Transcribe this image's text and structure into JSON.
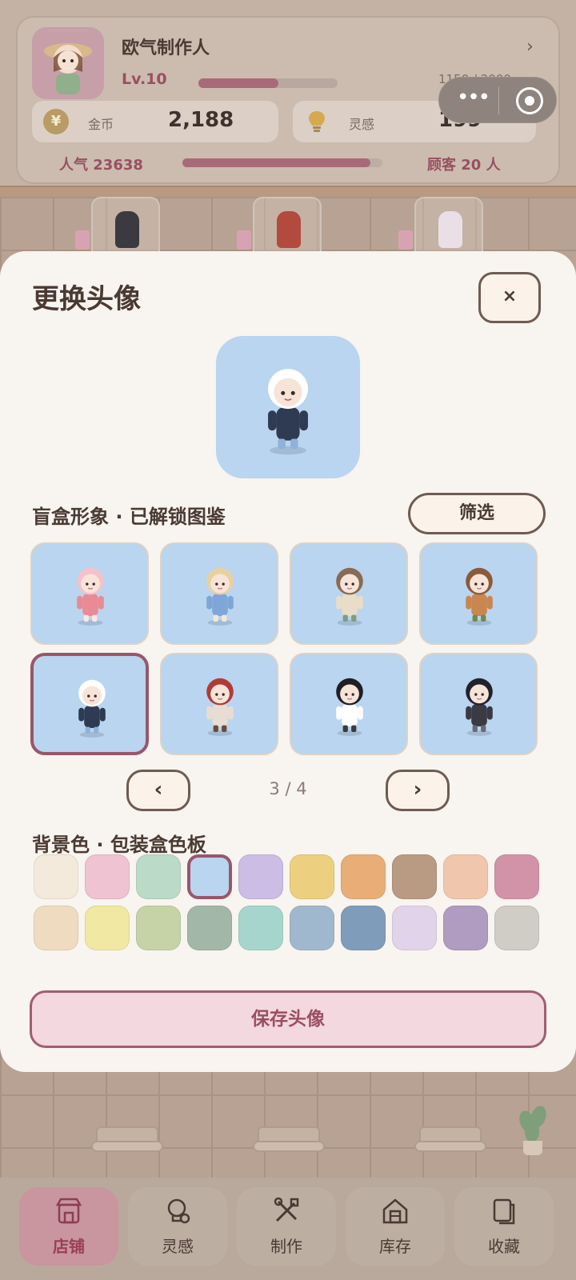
{
  "header": {
    "name": "欧气制作人",
    "level": "Lv.10",
    "xp_text": "1150 / 2000",
    "xp_progress": 0.575,
    "coins_label": "金币",
    "coins_value": "2,188",
    "coin_icon_char": "¥",
    "inspiration_label": "灵感",
    "inspiration_value": "199",
    "popularity": "人气 23638",
    "popularity_progress": 0.94,
    "customers": "顾客 20 人",
    "chevron": "›"
  },
  "modal": {
    "title": "更换头像",
    "close_label": "×",
    "section_figures": "盲盒形象 · 已解锁图鉴",
    "filter_label": "筛选",
    "pager_prev": "‹",
    "pager_next": "›",
    "page_indicator": "3 / 4",
    "section_colors": "背景色 · 包装盒色板",
    "save_label": "保存头像",
    "selected_figure_index": 4,
    "selected_color_index": 3,
    "figures": [
      {
        "name": "strawberry-cake-girl",
        "colors": [
          "#f4c2c8",
          "#e98a95",
          "#fbe6e0"
        ]
      },
      {
        "name": "sun-hat-girl",
        "colors": [
          "#e8d1a0",
          "#7fa6d8",
          "#f3e7d6"
        ]
      },
      {
        "name": "reading-glasses-girl",
        "colors": [
          "#8a6a52",
          "#e9ddc8",
          "#7f9e7a"
        ]
      },
      {
        "name": "squirrel",
        "colors": [
          "#8a5a3a",
          "#c9864f",
          "#6f8a4f"
        ]
      },
      {
        "name": "ski-boy",
        "colors": [
          "#ffffff",
          "#2f3b52",
          "#8fb2dc"
        ]
      },
      {
        "name": "red-hood-girl",
        "colors": [
          "#b23a36",
          "#e8ddd2",
          "#6e4a3a"
        ]
      },
      {
        "name": "black-hair-boy",
        "colors": [
          "#1f1f24",
          "#ffffff",
          "#3a3a40"
        ]
      },
      {
        "name": "scarf-boy",
        "colors": [
          "#22222a",
          "#3a3a44",
          "#6a6a72"
        ]
      }
    ],
    "palette": [
      "#f3eadc",
      "#efc3d1",
      "#bcdac8",
      "#b9d5ef",
      "#cbbde4",
      "#ecd07f",
      "#e9ae78",
      "#b99a82",
      "#f0c7ad",
      "#d293a8",
      "#efdcc0",
      "#f0e8a3",
      "#c6d3a7",
      "#a3b7a8",
      "#a6d5cd",
      "#a0b8cd",
      "#7f9cbb",
      "#e1d3ea",
      "#b09cc0",
      "#d0ccc6"
    ]
  },
  "capsule": {
    "more_label": "•••",
    "target_icon": "target-icon"
  },
  "tabs": [
    {
      "label": "店铺",
      "icon": "shop-icon"
    },
    {
      "label": "灵感",
      "icon": "bulb-icon"
    },
    {
      "label": "制作",
      "icon": "tools-icon"
    },
    {
      "label": "库存",
      "icon": "house-icon"
    },
    {
      "label": "收藏",
      "icon": "collection-icon"
    }
  ],
  "colors": {
    "accent": "#99566a",
    "panel": "#f8f4ef",
    "border": "#6e5b52"
  }
}
